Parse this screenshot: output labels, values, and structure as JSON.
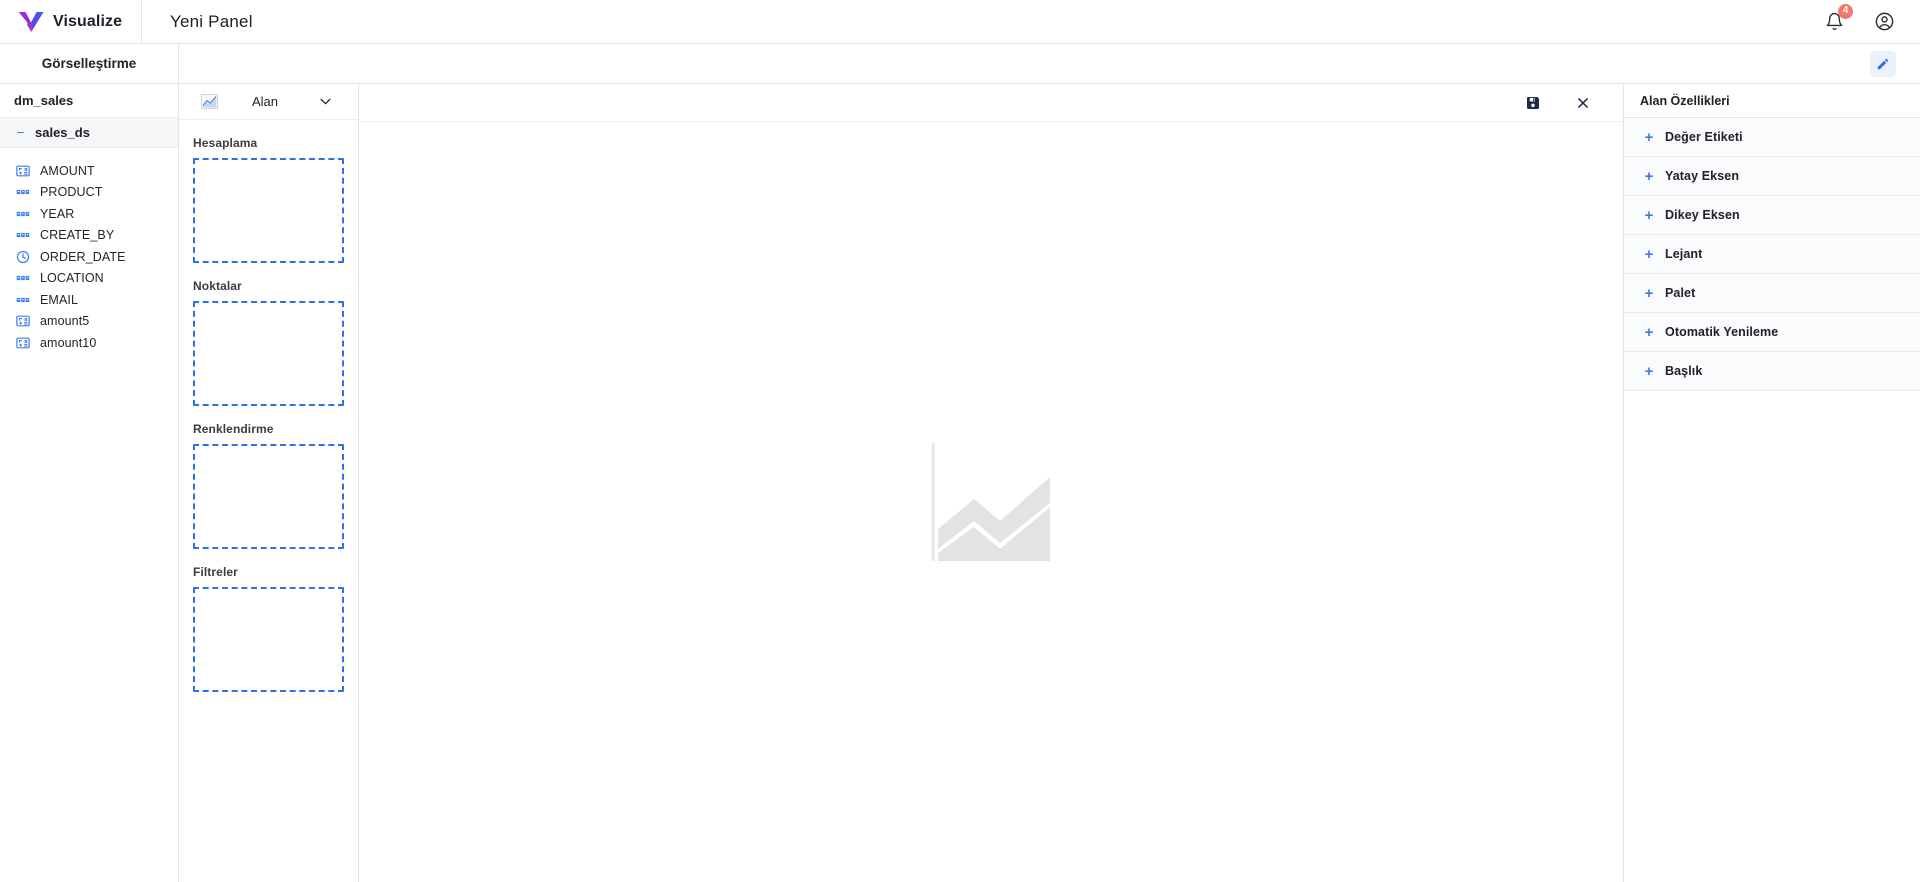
{
  "topbar": {
    "brand_name": "Visualize",
    "logo_icon": "visualize-v-logo",
    "panel_title": "Yeni Panel",
    "notification_icon": "bell-icon",
    "notification_count": "4",
    "account_icon": "account-circle-icon"
  },
  "subbar": {
    "visualization_tab": "Görselleştirme",
    "edit_icon": "pencil-icon"
  },
  "datapanel": {
    "datamart_name": "dm_sales",
    "dataset": {
      "label": "sales_ds",
      "collapse_icon": "minus-icon",
      "expanded": true
    },
    "fields": [
      {
        "label": "AMOUNT",
        "type": "measure",
        "icon": "numeric-field-icon"
      },
      {
        "label": "PRODUCT",
        "type": "string",
        "icon": "abc-field-icon"
      },
      {
        "label": "YEAR",
        "type": "string",
        "icon": "abc-field-icon"
      },
      {
        "label": "CREATE_BY",
        "type": "string",
        "icon": "abc-field-icon"
      },
      {
        "label": "ORDER_DATE",
        "type": "date",
        "icon": "clock-field-icon"
      },
      {
        "label": "LOCATION",
        "type": "string",
        "icon": "abc-field-icon"
      },
      {
        "label": "EMAIL",
        "type": "string",
        "icon": "abc-field-icon"
      },
      {
        "label": "amount5",
        "type": "measure",
        "icon": "numeric-field-icon"
      },
      {
        "label": "amount10",
        "type": "measure",
        "icon": "numeric-field-icon"
      }
    ]
  },
  "configpanel": {
    "chart_type_icon": "line-chart-icon",
    "mode_select": {
      "value": "Alan",
      "chevron_icon": "chevron-down-icon"
    },
    "zones": [
      {
        "label": "Hesaplama",
        "items": []
      },
      {
        "label": "Noktalar",
        "items": []
      },
      {
        "label": "Renklendirme",
        "items": []
      },
      {
        "label": "Filtreler",
        "items": []
      }
    ]
  },
  "canvas": {
    "save_icon": "save-floppy-icon",
    "close_icon": "close-x-icon",
    "placeholder_icon": "area-chart-placeholder-icon"
  },
  "proppanel": {
    "title": "Alan Özellikleri",
    "expand_icon": "plus-icon",
    "sections": [
      {
        "label": "Değer Etiketi"
      },
      {
        "label": "Yatay Eksen"
      },
      {
        "label": "Dikey Eksen"
      },
      {
        "label": "Lejant"
      },
      {
        "label": "Palet"
      },
      {
        "label": "Otomatik Yenileme"
      },
      {
        "label": "Başlık"
      }
    ]
  },
  "colors": {
    "accent_blue": "#2d70e8",
    "brand_purple": "#9b2fd6",
    "brand_blue": "#2a5ce8",
    "badge_red": "#f4766c",
    "panel_border": "#e2e4e8",
    "row_bg": "#fafbfc"
  }
}
